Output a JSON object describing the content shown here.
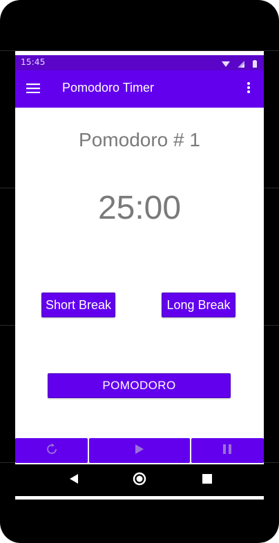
{
  "status_bar": {
    "time": "15:45",
    "icons": [
      "wifi-icon",
      "signal-icon",
      "battery-icon"
    ]
  },
  "app_bar": {
    "title": "Pomodoro Timer",
    "menu_icon": "menu-icon",
    "overflow_icon": "more-vertical-icon"
  },
  "main": {
    "session_label": "Pomodoro # 1",
    "timer_value": "25:00",
    "short_break_label": "Short Break",
    "long_break_label": "Long Break",
    "pomodoro_label": "POMODORO"
  },
  "controls": [
    {
      "name": "refresh",
      "icon": "refresh-icon"
    },
    {
      "name": "play",
      "icon": "play-icon"
    },
    {
      "name": "pause",
      "icon": "pause-icon"
    }
  ],
  "nav_bar": {
    "icons": [
      "back-icon",
      "home-icon",
      "recent-apps-icon"
    ]
  },
  "colors": {
    "primary": "#6200ee",
    "status_bar": "#5a05c7",
    "text_gray": "#7a7a7a",
    "control_icon": "#9b71d8"
  }
}
